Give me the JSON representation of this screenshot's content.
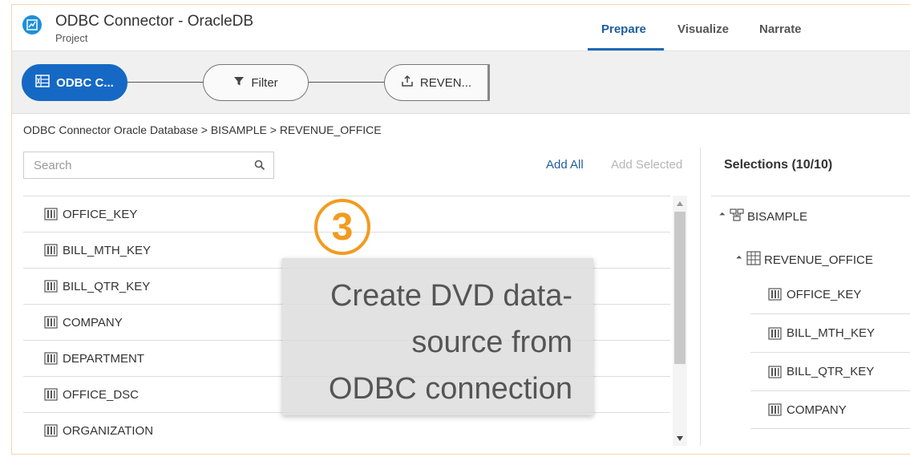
{
  "header": {
    "title": "ODBC Connector - OracleDB",
    "subtitle": "Project",
    "tabs": [
      {
        "label": "Prepare",
        "active": true
      },
      {
        "label": "Visualize",
        "active": false
      },
      {
        "label": "Narrate",
        "active": false
      }
    ]
  },
  "flow": {
    "steps": [
      {
        "label": "ODBC C...",
        "icon": "table-source-icon"
      },
      {
        "label": "Filter",
        "icon": "filter-icon"
      },
      {
        "label": "REVEN...",
        "icon": "upload-icon"
      }
    ]
  },
  "breadcrumb": "ODBC Connector Oracle Database > BISAMPLE > REVENUE_OFFICE",
  "search": {
    "placeholder": "Search",
    "value": ""
  },
  "actions": {
    "add_all": "Add All",
    "add_selected": "Add Selected"
  },
  "columns": [
    "OFFICE_KEY",
    "BILL_MTH_KEY",
    "BILL_QTR_KEY",
    "COMPANY",
    "DEPARTMENT",
    "OFFICE_DSC",
    "ORGANIZATION"
  ],
  "selections": {
    "title": "Selections (10/10)",
    "schema": "BISAMPLE",
    "table": "REVENUE_OFFICE",
    "columns": [
      "OFFICE_KEY",
      "BILL_MTH_KEY",
      "BILL_QTR_KEY",
      "COMPANY"
    ]
  },
  "callout": {
    "step_number": "3",
    "line1": "Create DVD data-",
    "line2": "source from",
    "line3": "ODBC connection"
  },
  "colors": {
    "accent": "#1569c4",
    "tab_active": "#1d5c9e",
    "callout_badge": "#f39a1f"
  }
}
